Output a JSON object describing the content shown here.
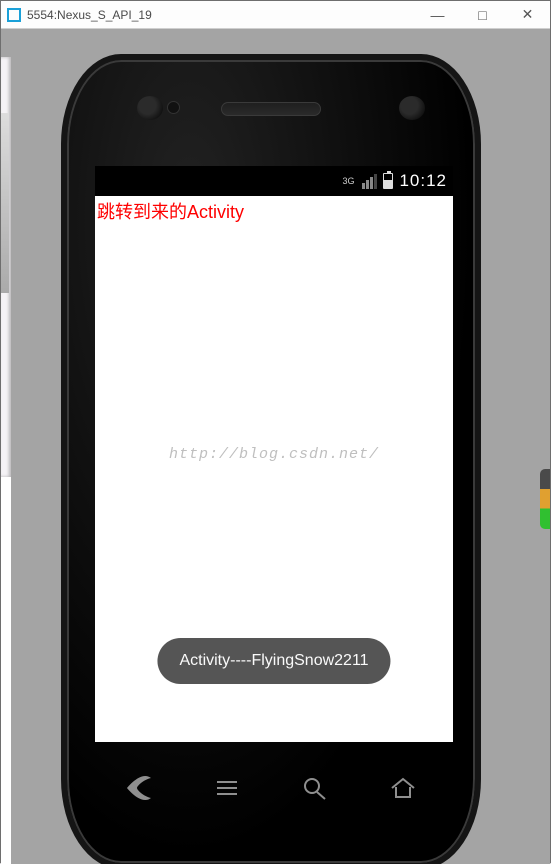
{
  "window": {
    "title": "5554:Nexus_S_API_19",
    "btn_min": "—",
    "btn_max": "□",
    "btn_close": "✕"
  },
  "statusbar": {
    "net_label": "3G",
    "time": "10:12"
  },
  "app": {
    "heading": "跳转到来的Activity"
  },
  "watermark": "http://blog.csdn.net/",
  "toast": "Activity----FlyingSnow2211"
}
